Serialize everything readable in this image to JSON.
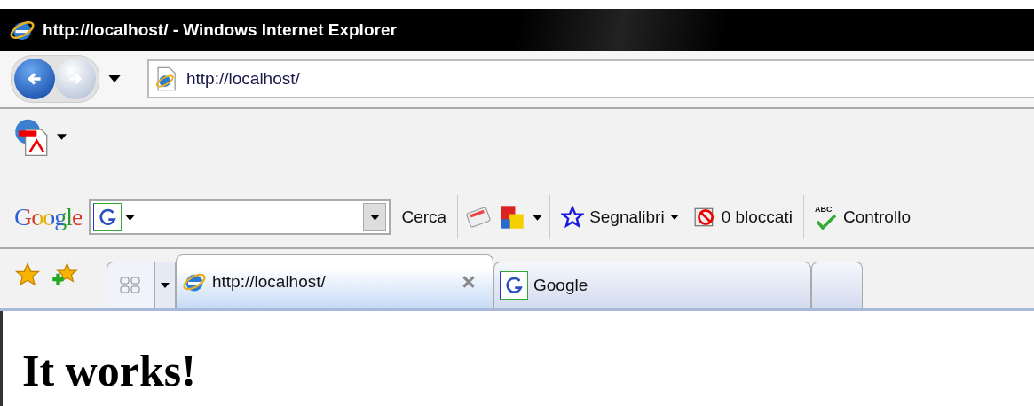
{
  "window": {
    "title": "http://localhost/ - Windows Internet Explorer"
  },
  "address_bar": {
    "value": "http://localhost/"
  },
  "google_toolbar": {
    "logo": "Google",
    "search_button": "Cerca",
    "bookmarks": "Segnalibri",
    "popups_blocked": "0 bloccati",
    "spellcheck_badge": "ABC",
    "spellcheck": "Controllo"
  },
  "tabs": [
    {
      "label": "http://localhost/",
      "kind": "ie",
      "selected": true,
      "closable": true
    },
    {
      "label": "Google",
      "kind": "google",
      "selected": false,
      "closable": false
    },
    {
      "kind": "new",
      "selected": false,
      "closable": false
    }
  ],
  "page": {
    "heading": "It works!"
  }
}
